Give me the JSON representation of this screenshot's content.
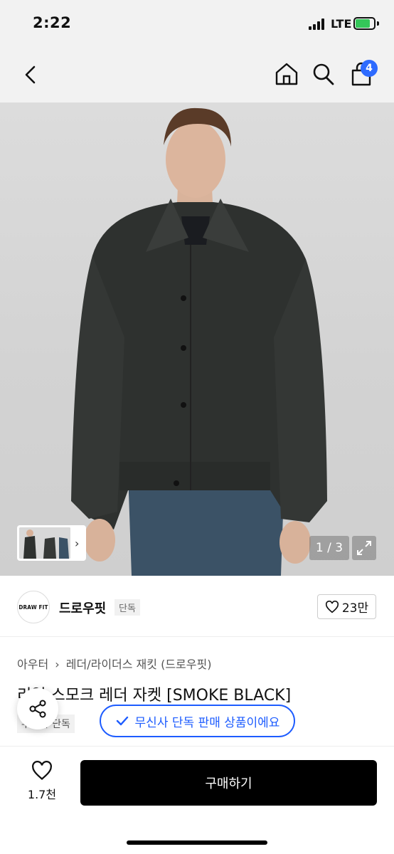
{
  "status": {
    "time": "2:22",
    "network": "LTE"
  },
  "nav": {
    "cart_count": "4"
  },
  "hero": {
    "pager": "1 / 3"
  },
  "brand": {
    "logo_text": "DRAW FIT",
    "name": "드로우핏",
    "tag": "단독",
    "like_count": "23만"
  },
  "breadcrumb": {
    "category": "아우터",
    "sub_category": "레더/라이더스 재킷 (드로우핏)"
  },
  "product": {
    "title": "리얼 스모크 레더 자켓 [SMOKE BLACK]",
    "exclusive_tag": "무신사 단독",
    "exclusive_notice": "무신사 단독 판매 상품이에요"
  },
  "bottom": {
    "like_count": "1.7천",
    "buy_label": "구매하기"
  },
  "colors": {
    "accent_blue": "#1d5cff",
    "badge_blue": "#2e6bff",
    "buy_button": "#000000"
  }
}
